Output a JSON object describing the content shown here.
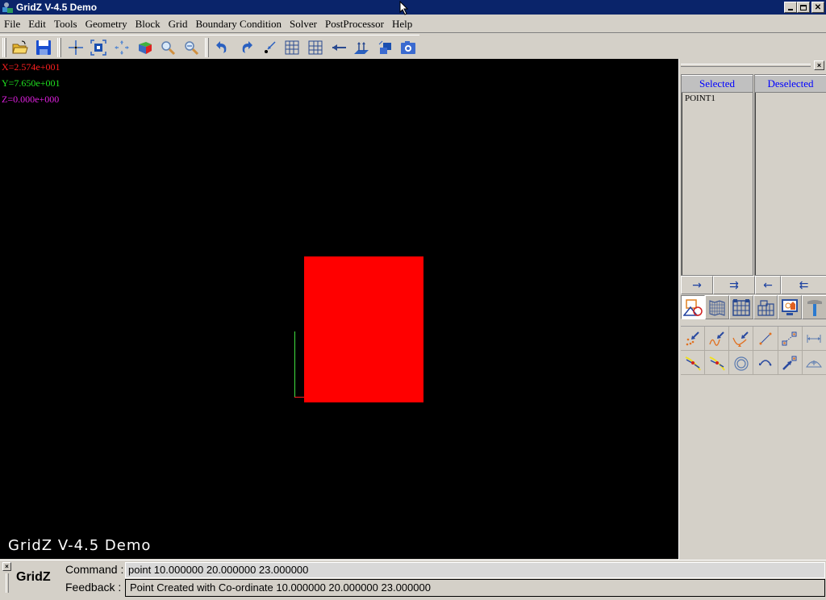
{
  "window": {
    "title": "GridZ  V-4.5 Demo",
    "controls": {
      "minimize": "_",
      "restore": "▭",
      "close": "✕"
    }
  },
  "menu": [
    "File",
    "Edit",
    "Tools",
    "Geometry",
    "Block",
    "Grid",
    "Boundary Condition",
    "Solver",
    "PostProcessor",
    "Help"
  ],
  "toolbar": {
    "icons": [
      "open-folder-icon",
      "save-icon",
      "pan-icon",
      "fit-view-icon",
      "move-icon",
      "render-cube-icon",
      "zoom-in-icon",
      "zoom-out-icon",
      "undo-icon",
      "redo-icon",
      "pick-point-icon",
      "grid-icon",
      "grid-alt-icon",
      "arrow-left-icon",
      "surface-normals-icon",
      "copy-block-icon",
      "camera-icon"
    ]
  },
  "viewport": {
    "coords": {
      "x": "X=2.574e+001",
      "y": "Y=7.650e+001",
      "z": "Z=0.000e+000"
    },
    "colors": {
      "x": "#ff2020",
      "y": "#20e020",
      "z": "#e020e0",
      "shape": "#ff0000",
      "background": "#000000"
    },
    "watermark": "GridZ  V-4.5 Demo"
  },
  "side_panel": {
    "close": "×",
    "selected_header": "Selected",
    "deselected_header": "Deselected",
    "selected_items": [
      "POINT1"
    ],
    "deselected_items": [],
    "transfer_buttons": [
      "→",
      "⇉",
      "←",
      "⇇"
    ],
    "mode_icons": [
      "geometry-mode-icon",
      "surface-mesh-icon",
      "block-mode-icon",
      "grid-blocks-icon",
      "display-mode-icon",
      "hammer-tools-icon"
    ],
    "active_mode": 0,
    "tool_icons": [
      "point-from-points-icon",
      "point-on-curve-icon",
      "point-intersection-icon",
      "point-by-distance-icon",
      "point-translate-icon",
      "measure-distance-icon",
      "curve-intersect-icon",
      "curve-intersect-alt-icon",
      "circle-center-icon",
      "rotate-point-icon",
      "project-point-icon",
      "arc-point-icon"
    ]
  },
  "command_bar": {
    "close": "×",
    "brand": "GridZ",
    "command_label": "Command :",
    "command_value": "point 10.000000 20.000000 23.000000",
    "feedback_label": "Feedback :",
    "feedback_value": "Point Created with Co-ordinate 10.000000 20.000000 23.000000"
  }
}
